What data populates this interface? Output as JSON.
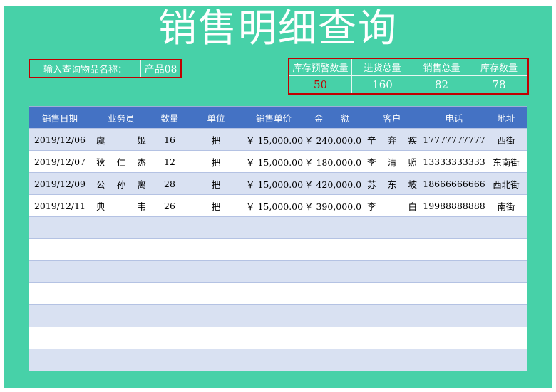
{
  "title": "销售明细查询",
  "query": {
    "label": "输入查询物品名称：",
    "value": "产品08"
  },
  "stats": {
    "headers": [
      "库存预警数量",
      "进货总量",
      "销售总量",
      "库存数量"
    ],
    "values": [
      "50",
      "160",
      "82",
      "78"
    ]
  },
  "table": {
    "headers": [
      "销售日期",
      "业务员",
      "数量",
      "单位",
      "销售单价",
      "金　　额",
      "客户",
      "电话",
      "地址"
    ],
    "rows": [
      {
        "date": "2019/12/06",
        "rep": [
          "虞",
          "姬"
        ],
        "qty": "16",
        "unit": "把",
        "price": "￥ 15,000.00",
        "amount": "￥ 240,000.00",
        "customer": [
          "辛",
          "弃",
          "疾"
        ],
        "phone": "17777777777",
        "address": "西街"
      },
      {
        "date": "2019/12/07",
        "rep": [
          "狄",
          "仁",
          "杰"
        ],
        "qty": "12",
        "unit": "把",
        "price": "￥ 15,000.00",
        "amount": "￥ 180,000.00",
        "customer": [
          "李",
          "清",
          "照"
        ],
        "phone": "13333333333",
        "address": "东南街"
      },
      {
        "date": "2019/12/09",
        "rep": [
          "公",
          "孙",
          "离"
        ],
        "qty": "28",
        "unit": "把",
        "price": "￥ 15,000.00",
        "amount": "￥ 420,000.00",
        "customer": [
          "苏",
          "东",
          "坡"
        ],
        "phone": "18666666666",
        "address": "西北街"
      },
      {
        "date": "2019/12/11",
        "rep": [
          "典",
          "韦"
        ],
        "qty": "26",
        "unit": "把",
        "price": "￥ 15,000.00",
        "amount": "￥ 390,000.00",
        "customer": [
          "李",
          "白"
        ],
        "phone": "19988888888",
        "address": "南街"
      }
    ],
    "empty_rows": 7
  },
  "colors": {
    "background": "#47d1a8",
    "header": "#4472c4",
    "band": "#d9e1f2",
    "alert": "#c00000"
  }
}
